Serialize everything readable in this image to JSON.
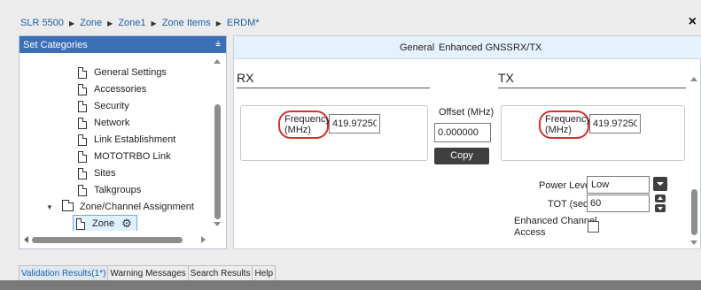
{
  "breadcrumb": {
    "items": [
      "SLR 5500",
      "Zone",
      "Zone1",
      "Zone Items",
      "ERDM*"
    ],
    "separator": "▶"
  },
  "close_label": "×",
  "left_panel": {
    "title": "Set Categories",
    "pin_icon": "📌",
    "tree": [
      "General Settings",
      "Accessories",
      "Security",
      "Network",
      "Link Establishment",
      "MOTOTRBO Link",
      "Sites",
      "Talkgroups"
    ],
    "folder_label": "Zone/Channel Assignment",
    "selected_label": "Zone"
  },
  "right_panel": {
    "tabs": [
      "General",
      "Enhanced GNSS",
      "RX/TX"
    ],
    "rx": {
      "title": "RX",
      "freq_label_1": "Frequency",
      "freq_label_2": "(MHz)",
      "freq_value": "419.972500"
    },
    "offset": {
      "label": "Offset (MHz)",
      "value": "0.000000",
      "copy_label": "Copy"
    },
    "tx": {
      "title": "TX",
      "freq_label_1": "Frequency",
      "freq_label_2": "(MHz)",
      "freq_value": "419.972500",
      "power_label": "Power Level",
      "power_value": "Low",
      "tot_label": "TOT (sec)",
      "tot_value": "60",
      "eca_label_1": "Enhanced Channel",
      "eca_label_2": "Access"
    }
  },
  "bottom_tabs": [
    "Validation Results(1*)",
    "Warning Messages",
    "Search Results",
    "Help"
  ],
  "colors": {
    "accent": "#3b6fb6",
    "link": "#1f5fa8",
    "highlight_oval": "#d0312d",
    "button_dark": "#3f3f3f"
  }
}
